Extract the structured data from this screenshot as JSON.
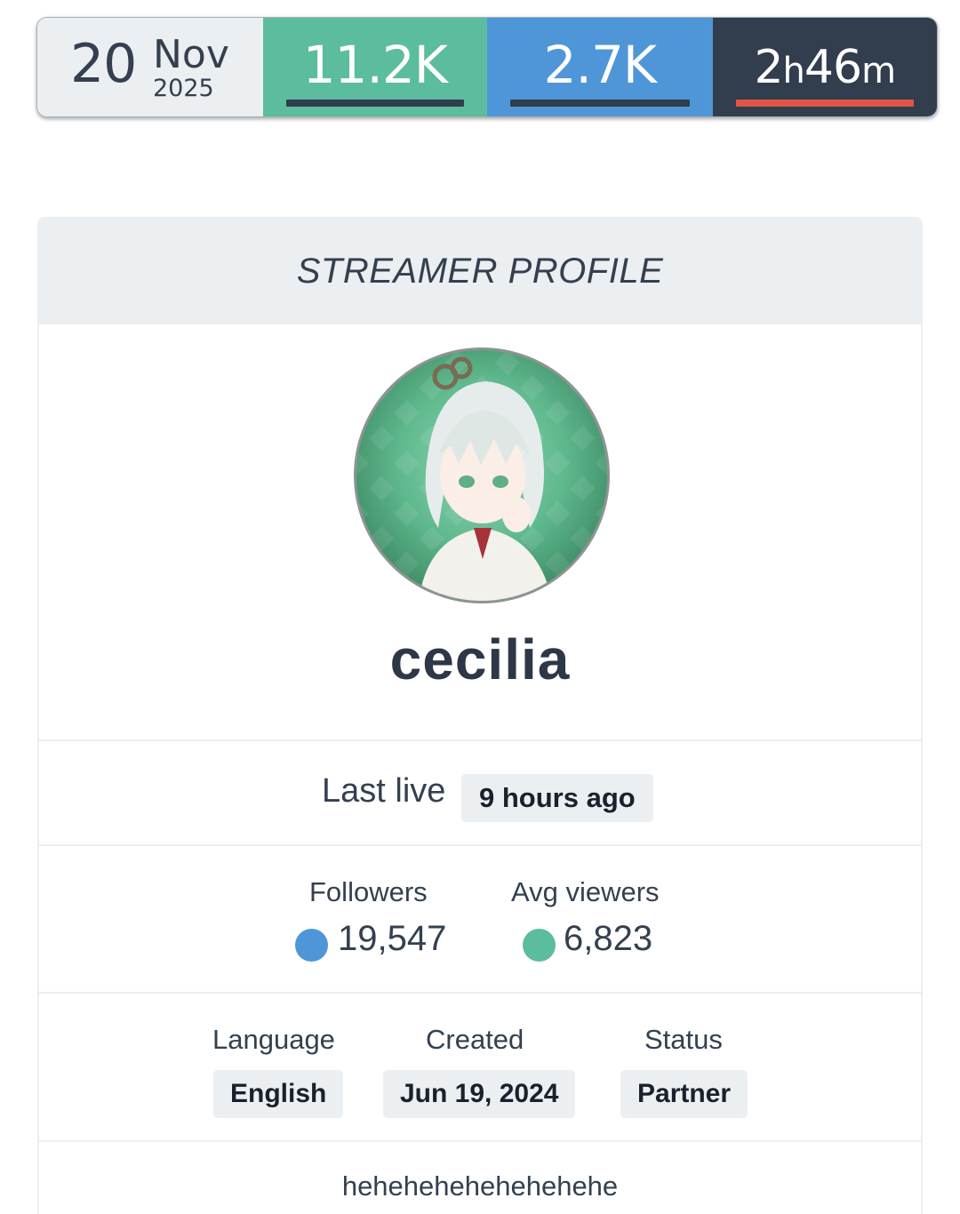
{
  "stats_bar": {
    "date": {
      "day": "20",
      "month": "Nov",
      "year": "2025"
    },
    "stat_green": {
      "value": "11.2K"
    },
    "stat_blue": {
      "value": "2.7K"
    },
    "stat_duration": {
      "hours": "2",
      "hours_unit": "h",
      "minutes": "46",
      "minutes_unit": "m"
    },
    "colors": {
      "green": "#5bbd9d",
      "blue": "#4f96d8",
      "dark": "#323d4e",
      "accent_red": "#e05546"
    }
  },
  "profile": {
    "header_title": "STREAMER PROFILE",
    "avatar": {
      "description": "anime-avatar-image"
    },
    "username": "cecilia",
    "last_live": {
      "label": "Last live",
      "value": "9 hours ago"
    },
    "followers": {
      "label": "Followers",
      "value": "19,547",
      "dot_color": "#4f96d8"
    },
    "avg_viewers": {
      "label": "Avg viewers",
      "value": "6,823",
      "dot_color": "#5bbd9d"
    },
    "language": {
      "label": "Language",
      "value": "English"
    },
    "created": {
      "label": "Created",
      "value": "Jun 19, 2024"
    },
    "status": {
      "label": "Status",
      "value": "Partner"
    },
    "bio": "hehehehehehehehehe"
  }
}
